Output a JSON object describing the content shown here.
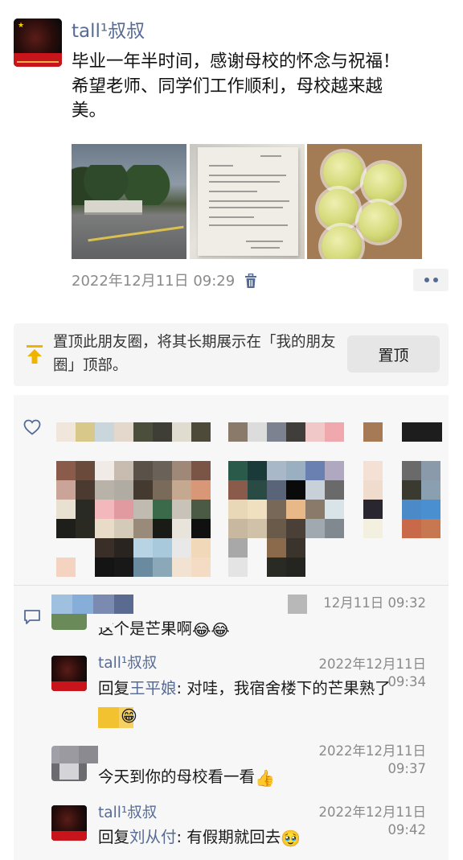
{
  "post": {
    "author": "tall¹叔叔",
    "text": "毕业一年半时间，感谢母校的怀念与祝福！\n希望老师、同学们工作顺利，母校越来越\n美。",
    "time": "2022年12月11日 09:29",
    "photos": [
      "campus-gate-photo",
      "document-photo",
      "pears-photo"
    ]
  },
  "pin": {
    "text": "置顶此朋友圈，将其长期展示在「我的朋友圈」顶部。",
    "button": "置顶"
  },
  "comments": [
    {
      "name": "",
      "time": "12月11日 09:32",
      "text": "这个是芒果啊",
      "emoji": "😂😂"
    },
    {
      "name": "tall¹叔叔",
      "time": "2022年12月11日 09:34",
      "prefix": "回复",
      "reply_to": "王平娘",
      "text": ": 对哇，我宿舍楼下的芒果熟了",
      "emoji": "😁"
    },
    {
      "name": "",
      "time": "2022年12月11日 09:37",
      "text": "今天到你的母校看一看",
      "emoji": "👍"
    },
    {
      "name": "tall¹叔叔",
      "time": "2022年12月11日 09:42",
      "prefix": "回复",
      "reply_to": "刘从付",
      "text": ": 有假期就回去",
      "emoji": "🥹"
    }
  ],
  "colors": {
    "link_blue": "#576b95",
    "time_gray": "#8a8a8a",
    "panel_bg": "#f7f7f7"
  },
  "icons": [
    "trash-icon",
    "more-dots-icon",
    "pin-top-icon",
    "heart-icon",
    "comment-icon"
  ]
}
